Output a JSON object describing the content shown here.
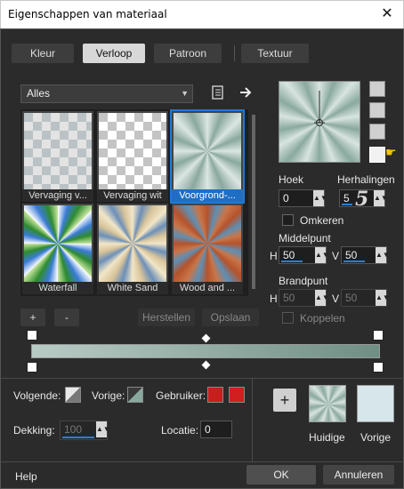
{
  "window": {
    "title": "Eigenschappen van materiaal",
    "close_glyph": "✕"
  },
  "tabs": [
    {
      "label": "Kleur",
      "active": false
    },
    {
      "label": "Verloop",
      "active": true
    },
    {
      "label": "Patroon",
      "active": false
    },
    {
      "label": "Textuur",
      "active": false
    }
  ],
  "category": {
    "selected": "Alles"
  },
  "thumbnails": [
    {
      "label": "Vervaging v...",
      "selected": false
    },
    {
      "label": "Vervaging wit",
      "selected": false
    },
    {
      "label": "Voorgrond-...",
      "selected": true
    },
    {
      "label": "Waterfall",
      "selected": false
    },
    {
      "label": "White Sand",
      "selected": false
    },
    {
      "label": "Wood and ...",
      "selected": false
    }
  ],
  "list_buttons": {
    "add": "+",
    "remove": "-",
    "restore": "Herstellen",
    "save": "Opslaan"
  },
  "fields": {
    "angle_label": "Hoek",
    "angle_value": "0",
    "repeats_label": "Herhalingen",
    "repeats_value": "5",
    "invert_label": "Omkeren",
    "center_label": "Middelpunt",
    "center_h_label": "H",
    "center_h_value": "50",
    "center_v_label": "V",
    "center_v_value": "50",
    "focal_label": "Brandpunt",
    "focal_h_label": "H",
    "focal_h_value": "50",
    "focal_v_label": "V",
    "focal_v_value": "50",
    "link_label": "Koppelen"
  },
  "annotation": {
    "step_number": "5"
  },
  "bottom": {
    "next_label": "Volgende:",
    "prev_label": "Vorige:",
    "user_label": "Gebruiker:",
    "opacity_label": "Dekking:",
    "opacity_value": "100",
    "location_label": "Locatie:",
    "location_value": "0",
    "add_glyph": "+",
    "current_label": "Huidige",
    "previous_label": "Vorige"
  },
  "footer": {
    "help": "Help",
    "ok": "OK",
    "cancel": "Annuleren"
  },
  "colors": {
    "accent": "#1e7ad6",
    "user_swatch_1": "#c81e1e",
    "user_swatch_2": "#d11f1f",
    "gradient_start": "#b8ccc6",
    "gradient_end": "#6f8f84"
  }
}
